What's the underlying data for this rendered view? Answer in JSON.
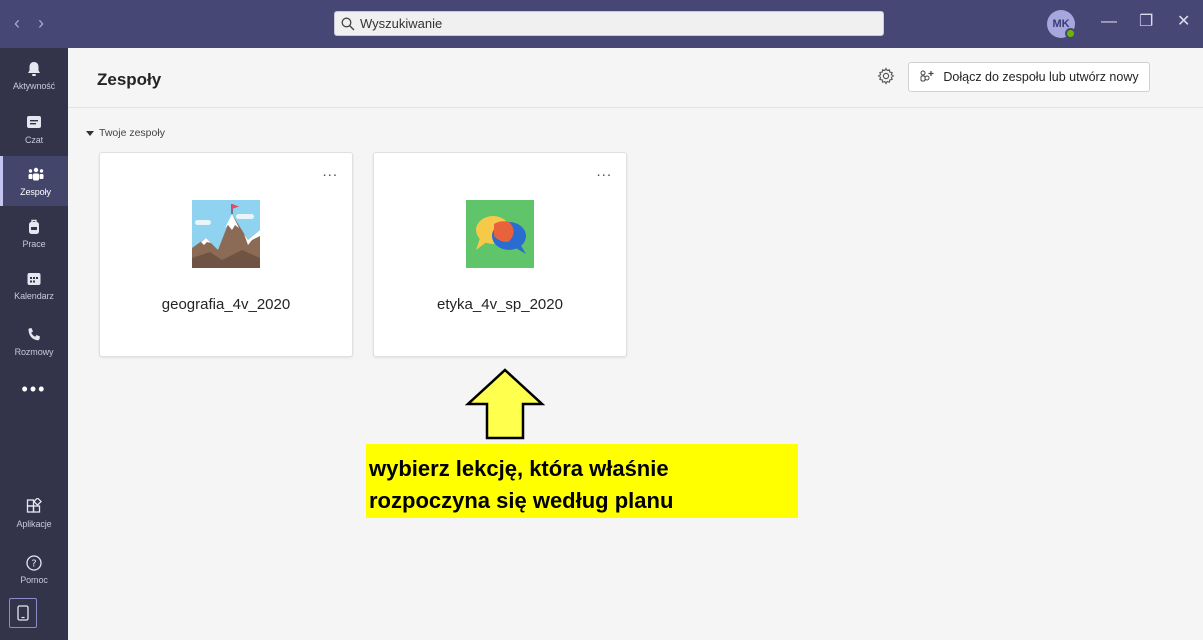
{
  "titlebar": {
    "search_placeholder": "Wyszukiwanie",
    "avatar_initials": "MK",
    "back_icon": "chevron-left-icon",
    "forward_icon": "chevron-right-icon",
    "minimize_glyph": "—",
    "maximize_glyph": "❐",
    "close_glyph": "✕"
  },
  "rail": {
    "items": [
      {
        "label": "Aktywność",
        "icon": "bell-icon"
      },
      {
        "label": "Czat",
        "icon": "chat-icon"
      },
      {
        "label": "Zespoły",
        "icon": "teams-icon"
      },
      {
        "label": "Prace",
        "icon": "backpack-icon"
      },
      {
        "label": "Kalendarz",
        "icon": "calendar-icon"
      },
      {
        "label": "Rozmowy",
        "icon": "phone-icon"
      }
    ],
    "more": "•••",
    "bottom_items": [
      {
        "label": "Aplikacje",
        "icon": "apps-icon"
      },
      {
        "label": "Pomoc",
        "icon": "help-icon"
      }
    ],
    "active": "Zespoły"
  },
  "header": {
    "title": "Zespoły",
    "join_label": "Dołącz do zespołu lub utwórz nowy"
  },
  "section": {
    "label": "Twoje zespoły"
  },
  "teams": [
    {
      "name": "geografia_4v_2020",
      "more": "..."
    },
    {
      "name": "etyka_4v_sp_2020",
      "more": "..."
    }
  ],
  "annotation": {
    "line1": "wybierz lekcję, która właśnie",
    "line2": "rozpoczyna się według planu"
  },
  "colors": {
    "titlebar": "#464775",
    "rail": "#33344a",
    "highlight": "#ffff00",
    "arrow_fill": "#ffff4d"
  }
}
